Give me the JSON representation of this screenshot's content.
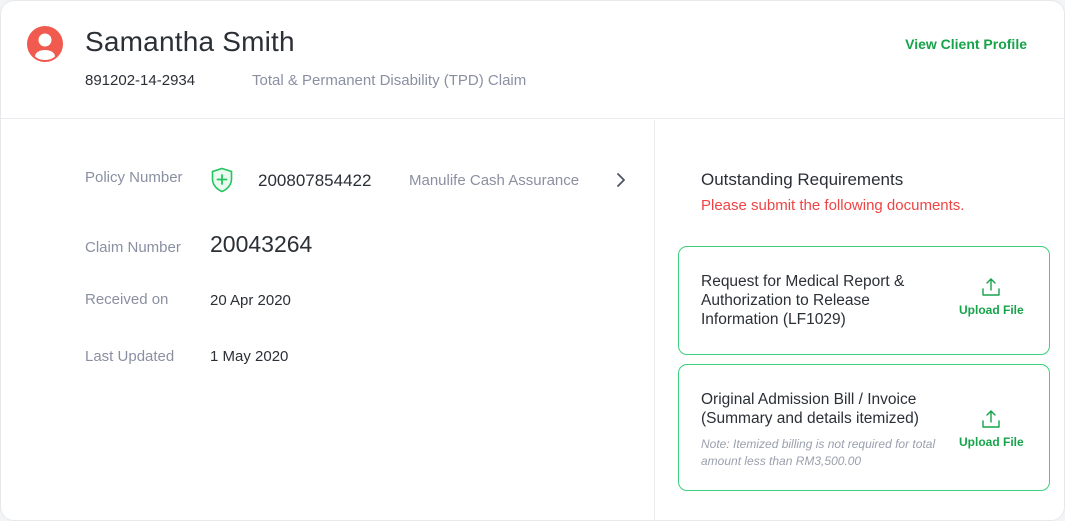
{
  "header": {
    "client_name": "Samantha Smith",
    "client_id": "891202-14-2934",
    "claim_type": "Total & Permanent Disability (TPD) Claim",
    "view_profile_label": "View Client Profile"
  },
  "details": {
    "policy_label": "Policy Number",
    "policy_number": "200807854422",
    "policy_plan": "Manulife Cash Assurance",
    "claim_label": "Claim Number",
    "claim_number": "20043264",
    "received_label": "Received on",
    "received_value": "20 Apr 2020",
    "updated_label": "Last Updated",
    "updated_value": "1 May 2020"
  },
  "requirements": {
    "title": "Outstanding Requirements",
    "subtitle": "Please submit the following documents.",
    "items": [
      {
        "text": "Request for Medical Report & Authorization to Release Information (LF1029)",
        "upload_label": "Upload File"
      },
      {
        "text": "Original Admission Bill / Invoice (Summary and details itemized)",
        "note": "Note: Itemized billing is not required for total amount less than RM3,500.00",
        "upload_label": "Upload File"
      }
    ]
  },
  "icons": {
    "avatar": "user-avatar-icon",
    "shield": "shield-plus-icon",
    "chevron": "chevron-right-icon",
    "upload": "upload-icon"
  },
  "colors": {
    "accent_green": "#16a34a",
    "box_border": "#3ccf7d",
    "alert_red": "#ef4444",
    "avatar_red": "#f05a4f",
    "muted_text": "#8a90a2"
  }
}
